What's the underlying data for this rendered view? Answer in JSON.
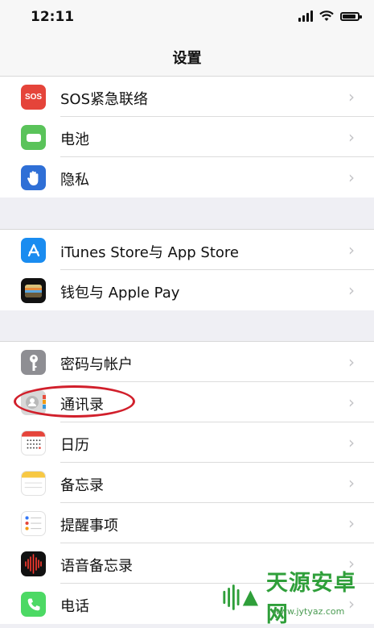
{
  "status_bar": {
    "time": "12:11"
  },
  "nav": {
    "title": "设置"
  },
  "group1": [
    {
      "label": "SOS紧急联络",
      "icon": "sos-icon",
      "icon_text": "SOS",
      "color": "#e5443a"
    },
    {
      "label": "电池",
      "icon": "battery-icon",
      "color": "#5ac35a"
    },
    {
      "label": "隐私",
      "icon": "hand-icon",
      "color": "#2f6fd6"
    }
  ],
  "group2": [
    {
      "label": "iTunes Store与 App Store",
      "icon": "app-store-icon",
      "color": "#1a8cf0"
    },
    {
      "label": "钱包与 Apple Pay",
      "icon": "wallet-icon",
      "color": "#111111"
    }
  ],
  "group3": [
    {
      "label": "密码与帐户",
      "icon": "key-icon",
      "color": "#8e8e93"
    },
    {
      "label": "通讯录",
      "icon": "contacts-icon",
      "color": "#d8d8d8"
    },
    {
      "label": "日历",
      "icon": "calendar-icon",
      "color": "#ffffff"
    },
    {
      "label": "备忘录",
      "icon": "notes-icon",
      "color": "#ffffff"
    },
    {
      "label": "提醒事项",
      "icon": "reminders-icon",
      "color": "#ffffff"
    },
    {
      "label": "语音备忘录",
      "icon": "voice-memos-icon",
      "color": "#111111"
    },
    {
      "label": "电话",
      "icon": "phone-icon",
      "color": "#4cd964"
    }
  ],
  "watermark": {
    "text": "天源安卓网",
    "url": "www.jytyaz.com"
  }
}
